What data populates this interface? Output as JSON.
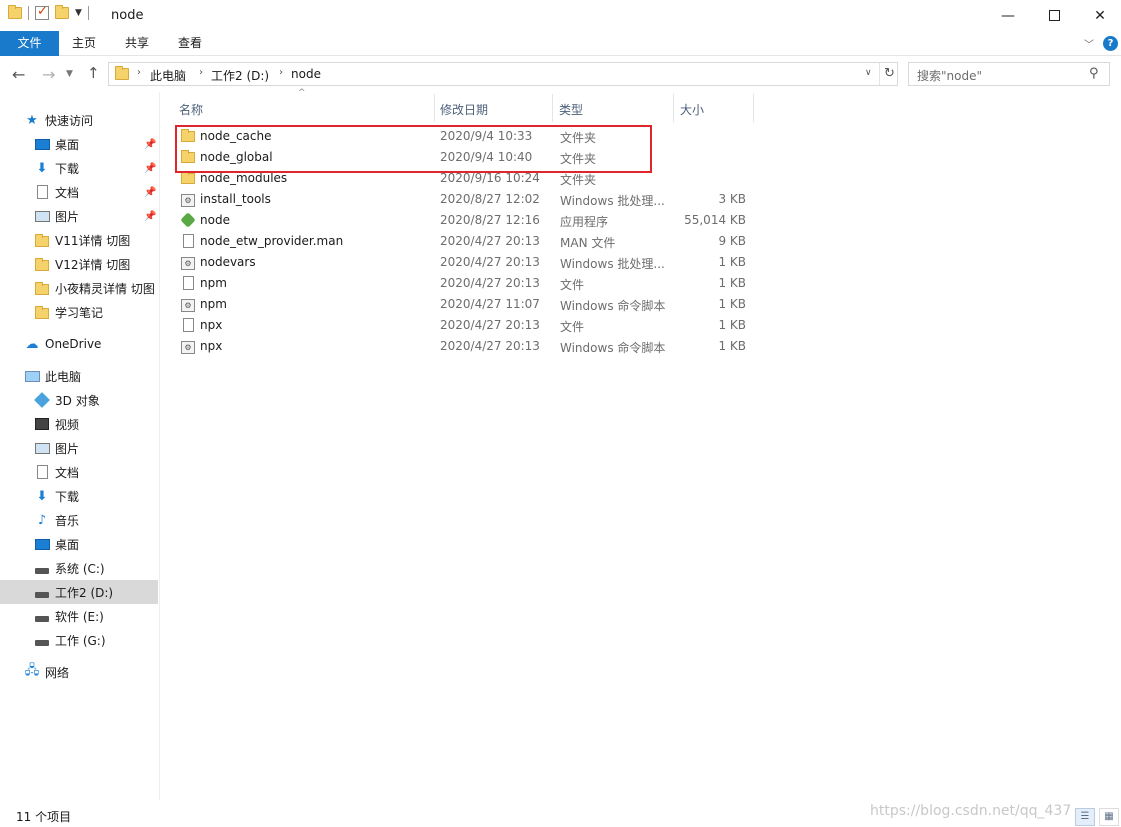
{
  "window": {
    "title": "node",
    "minimize": "—",
    "close": "✕"
  },
  "ribbon": {
    "tabs": [
      "文件",
      "主页",
      "共享",
      "查看"
    ],
    "help": "?"
  },
  "address": {
    "crumbs": [
      "此电脑",
      "工作2 (D:)",
      "node"
    ],
    "search_placeholder": "搜索\"node\""
  },
  "sidebar": {
    "quick_access": "快速访问",
    "quick_items": [
      {
        "label": "桌面",
        "pinned": true
      },
      {
        "label": "下载",
        "pinned": true
      },
      {
        "label": "文档",
        "pinned": true
      },
      {
        "label": "图片",
        "pinned": true
      },
      {
        "label": "V11详情 切图",
        "pinned": false
      },
      {
        "label": "V12详情 切图",
        "pinned": false
      },
      {
        "label": "小夜精灵详情 切图",
        "pinned": false
      },
      {
        "label": "学习笔记",
        "pinned": false
      }
    ],
    "onedrive": "OneDrive",
    "this_pc": "此电脑",
    "pc_items": [
      {
        "label": "3D 对象",
        "icon": "cube-icon"
      },
      {
        "label": "视频",
        "icon": "video-icon"
      },
      {
        "label": "图片",
        "icon": "picture-icon"
      },
      {
        "label": "文档",
        "icon": "document-icon"
      },
      {
        "label": "下载",
        "icon": "download-icon"
      },
      {
        "label": "音乐",
        "icon": "music-icon"
      },
      {
        "label": "桌面",
        "icon": "desktop-icon"
      },
      {
        "label": "系统 (C:)",
        "icon": "drive-icon"
      },
      {
        "label": "工作2 (D:)",
        "icon": "drive-icon",
        "selected": true
      },
      {
        "label": "软件 (E:)",
        "icon": "drive-icon"
      },
      {
        "label": "工作 (G:)",
        "icon": "drive-icon"
      }
    ],
    "network": "网络"
  },
  "columns": {
    "name": "名称",
    "date": "修改日期",
    "type": "类型",
    "size": "大小"
  },
  "files": [
    {
      "name": "node_cache",
      "date": "2020/9/4 10:33",
      "type": "文件夹",
      "size": "",
      "icon": "folder-icon"
    },
    {
      "name": "node_global",
      "date": "2020/9/4 10:40",
      "type": "文件夹",
      "size": "",
      "icon": "folder-icon"
    },
    {
      "name": "node_modules",
      "date": "2020/9/16 10:24",
      "type": "文件夹",
      "size": "",
      "icon": "folder-icon"
    },
    {
      "name": "install_tools",
      "date": "2020/8/27 12:02",
      "type": "Windows 批处理...",
      "size": "3 KB",
      "icon": "batch-file-icon"
    },
    {
      "name": "node",
      "date": "2020/8/27 12:16",
      "type": "应用程序",
      "size": "55,014 KB",
      "icon": "node-app-icon"
    },
    {
      "name": "node_etw_provider.man",
      "date": "2020/4/27 20:13",
      "type": "MAN 文件",
      "size": "9 KB",
      "icon": "file-icon"
    },
    {
      "name": "nodevars",
      "date": "2020/4/27 20:13",
      "type": "Windows 批处理...",
      "size": "1 KB",
      "icon": "batch-file-icon"
    },
    {
      "name": "npm",
      "date": "2020/4/27 20:13",
      "type": "文件",
      "size": "1 KB",
      "icon": "file-icon"
    },
    {
      "name": "npm",
      "date": "2020/4/27 11:07",
      "type": "Windows 命令脚本",
      "size": "1 KB",
      "icon": "batch-file-icon"
    },
    {
      "name": "npx",
      "date": "2020/4/27 20:13",
      "type": "文件",
      "size": "1 KB",
      "icon": "file-icon"
    },
    {
      "name": "npx",
      "date": "2020/4/27 20:13",
      "type": "Windows 命令脚本",
      "size": "1 KB",
      "icon": "batch-file-icon"
    }
  ],
  "status": {
    "count": "11 个项目",
    "watermark": "https://blog.csdn.net/qq_437"
  },
  "colors": {
    "accent": "#1979ca",
    "highlight": "#e0262d",
    "folder": "#f6d36a"
  }
}
